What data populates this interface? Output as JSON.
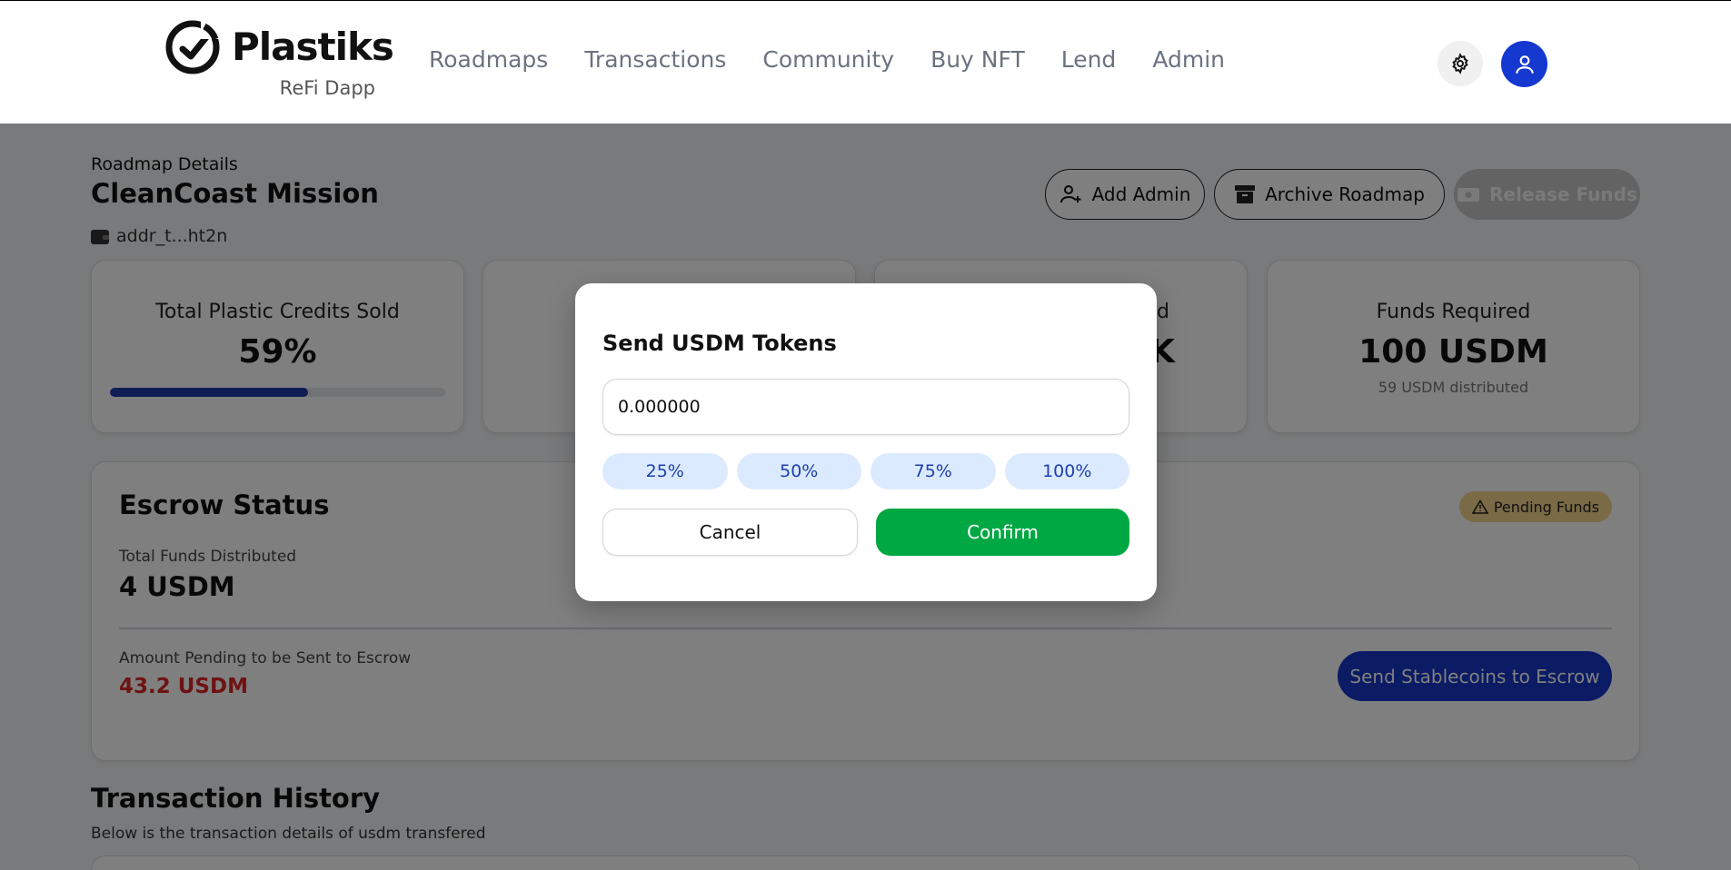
{
  "brand": {
    "name": "Plastiks",
    "tagline": "ReFi Dapp"
  },
  "nav": {
    "items": [
      {
        "label": "Roadmaps"
      },
      {
        "label": "Transactions"
      },
      {
        "label": "Community"
      },
      {
        "label": "Buy NFT"
      },
      {
        "label": "Lend"
      },
      {
        "label": "Admin"
      }
    ]
  },
  "header_icons": {
    "settings": "gear-icon",
    "profile": "user-icon"
  },
  "roadmap": {
    "pre_title": "Roadmap Details",
    "title": "CleanCoast Mission",
    "address": "addr_t...ht2n"
  },
  "actions": {
    "add_admin": "Add Admin",
    "archive": "Archive Roadmap",
    "release": "Release Funds"
  },
  "stats": {
    "credits_sold": {
      "label": "Total Plastic Credits Sold",
      "value": "59%",
      "progress": 0.59
    },
    "card2_partial": "",
    "card3_label_partial": "d",
    "card3_value_partial": "K",
    "funds_required": {
      "label": "Funds Required",
      "value": "100 USDM",
      "sub": "59 USDM distributed"
    }
  },
  "escrow": {
    "title": "Escrow Status",
    "badge": "Pending Funds",
    "total_label": "Total Funds Distributed",
    "total_value": "4 USDM",
    "pending_label": "Amount Pending to be Sent to Escrow",
    "pending_value": "43.2 USDM",
    "send_button": "Send Stablecoins to Escrow"
  },
  "transactions": {
    "title": "Transaction History",
    "subtitle": "Below is the transaction details of usdm transfered"
  },
  "modal": {
    "title": "Send USDM Tokens",
    "amount_value": "0.000000",
    "percent_options": [
      "25%",
      "50%",
      "75%",
      "100%"
    ],
    "cancel": "Cancel",
    "confirm": "Confirm"
  },
  "colors": {
    "primary": "#1636c9",
    "progress": "#1e3aa8",
    "confirm": "#00a843",
    "pending_text": "#dc2626",
    "badge": "#f5d48c",
    "pct_bg": "#dbeafe"
  }
}
